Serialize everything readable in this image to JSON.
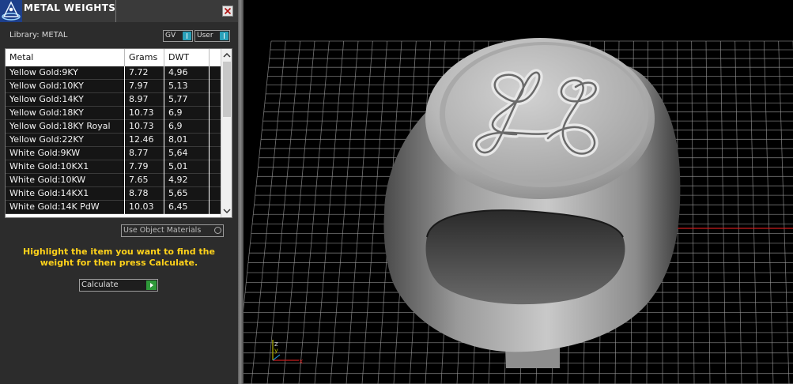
{
  "panel": {
    "title": "METAL WEIGHTS",
    "library_label": "Library: METAL",
    "gv_label": "GV",
    "user_label": "User",
    "table": {
      "headers": [
        "Metal",
        "Grams",
        "DWT"
      ],
      "rows": [
        [
          "Yellow Gold:9KY",
          "7.72",
          "4,96"
        ],
        [
          "Yellow Gold:10KY",
          "7.97",
          "5,13"
        ],
        [
          "Yellow Gold:14KY",
          "8.97",
          "5,77"
        ],
        [
          "Yellow Gold:18KY",
          "10.73",
          "6,9"
        ],
        [
          "Yellow Gold:18KY Royal",
          "10.73",
          "6,9"
        ],
        [
          "Yellow Gold:22KY",
          "12.46",
          "8,01"
        ],
        [
          "White Gold:9KW",
          "8.77",
          "5,64"
        ],
        [
          "White Gold:10KX1",
          "7.79",
          "5,01"
        ],
        [
          "White Gold:10KW",
          "7.65",
          "4,92"
        ],
        [
          "White Gold:14KX1",
          "8.78",
          "5,65"
        ],
        [
          "White Gold:14K PdW",
          "10.03",
          "6,45"
        ]
      ]
    },
    "use_object_materials": "Use Object Materials",
    "hint": "Highlight the item you want to find the weight for then press Calculate.",
    "calculate_label": "Calculate"
  },
  "viewport": {
    "axis_labels": {
      "x": "x",
      "y": "y",
      "z": "z"
    },
    "colors": {
      "x_axis": "#c81e1e",
      "y_axis": "#b8b800",
      "z_axis": "#1e8ac8",
      "grid": "#9a9a9a"
    }
  },
  "icons": [
    "app-logo-icon",
    "close-icon",
    "scroll-up-icon",
    "scroll-down-icon",
    "play-icon"
  ]
}
